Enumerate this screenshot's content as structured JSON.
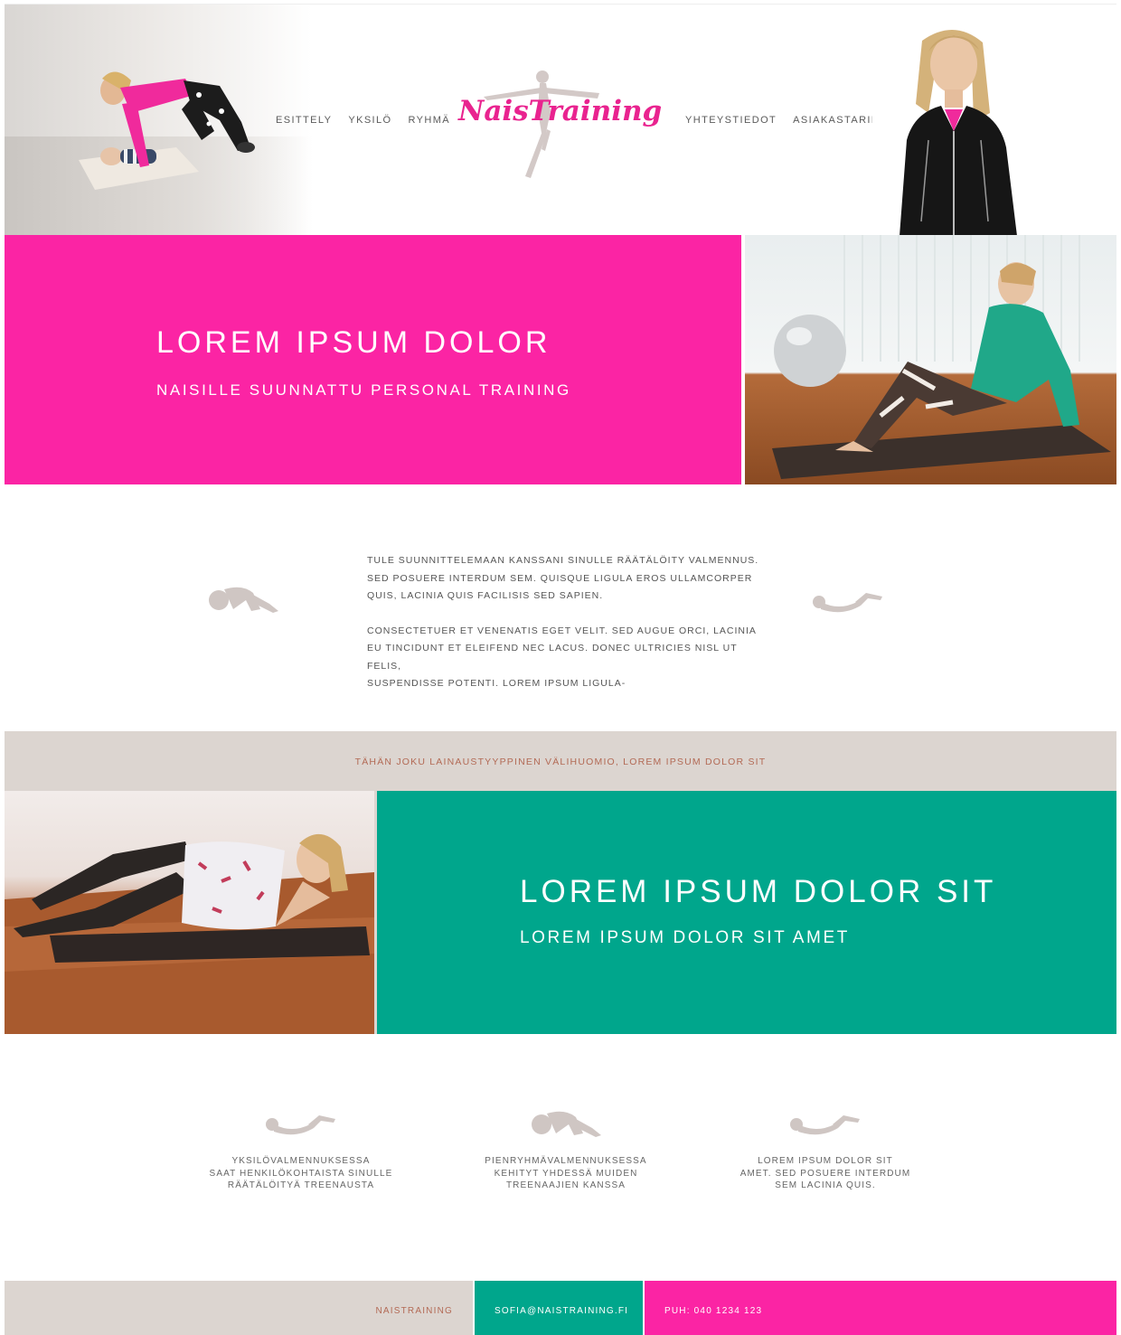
{
  "header": {
    "nav_left": [
      "ESITTELY",
      "YKSILÖ",
      "RYHMÄ"
    ],
    "nav_right": [
      "YHTEYSTIEDOT",
      "ASIAKASTARINAT"
    ],
    "logo_text": "NaisTraining"
  },
  "hero1": {
    "title": "LOREM IPSUM DOLOR",
    "subtitle": "NAISILLE SUUNNATTU PERSONAL TRAINING"
  },
  "intro": {
    "paragraph1_lines": [
      "TULE SUUNNITTELEMAAN KANSSANI SINULLE RÄÄTÄLÖITY VALMENNUS.",
      "SED POSUERE INTERDUM SEM. QUISQUE LIGULA EROS ULLAMCORPER",
      "QUIS, LACINIA QUIS FACILISIS SED SAPIEN."
    ],
    "paragraph2_lines": [
      "CONSECTETUER ET VENENATIS EGET VELIT. SED AUGUE ORCI, LACINIA",
      "EU TINCIDUNT ET ELEIFEND  NEC LACUS. DONEC ULTRICIES NISL UT FELIS,",
      "SUSPENDISSE POTENTI. LOREM IPSUM LIGULA-"
    ]
  },
  "quote": "TÄHÄN JOKU LAINAUSTYYPPINEN VÄLIHUOMIO, LOREM IPSUM DOLOR SIT",
  "hero2": {
    "title": "LOREM IPSUM DOLOR SIT",
    "subtitle": "LOREM IPSUM DOLOR SIT AMET"
  },
  "features": [
    {
      "icon": "lying-figure-icon",
      "lines": [
        "YKSILÖVALMENNUKSESSA",
        "SAAT HENKILÖKOHTAISTA SINULLE",
        "RÄÄTÄLÖITYÄ TREENAUSTA"
      ]
    },
    {
      "icon": "crouching-figure-icon",
      "lines": [
        "PIENRYHMÄVALMENNUKSESSA",
        "KEHITYT YHDESSÄ MUIDEN",
        "TREENAAJIEN KANSSA"
      ]
    },
    {
      "icon": "lying-figure-icon",
      "lines": [
        "LOREM IPSUM DOLOR SIT",
        "AMET. SED POSUERE INTERDUM",
        "SEM LACINIA QUIS."
      ]
    }
  ],
  "footer": {
    "name": "NAISTRAINING",
    "email": "SOFIA@NAISTRAINING.FI",
    "phone": "PUH: 040 1234 123"
  },
  "colors": {
    "pink": "#fb24a4",
    "teal": "#00a68c",
    "beige": "#dcd5d0",
    "silhouette": "#cfc6c3",
    "quote_text": "#b36a55"
  }
}
